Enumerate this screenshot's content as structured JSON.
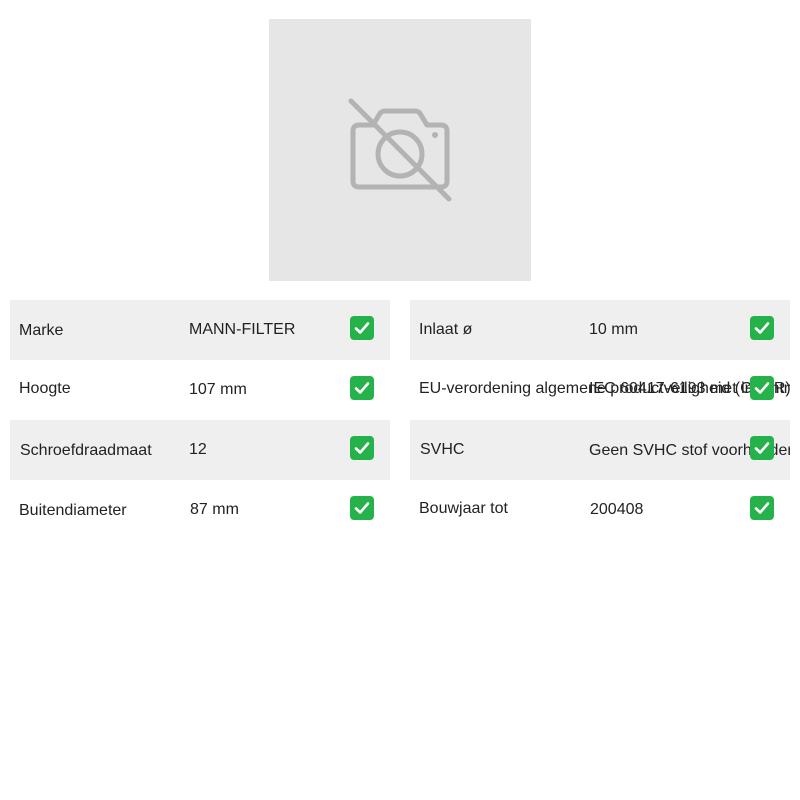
{
  "product_image": {
    "icon": "no-photo-icon"
  },
  "specs_left": [
    {
      "label": "Marke",
      "value": "MANN-FILTER"
    },
    {
      "label": "Hoogte",
      "value": "107 mm"
    },
    {
      "label": "Schroefdraadmaat",
      "value": "12"
    },
    {
      "label": "Buitendiameter",
      "value": "87 mm"
    }
  ],
  "specs_right": [
    {
      "label": "Inlaat ø",
      "value": "10 mm"
    },
    {
      "label": "EU-verordening algemene productveiligheid (GPSR)",
      "value": "IEC 60417-6193 met inachtneming"
    },
    {
      "label": "SVHC",
      "value": "Geen SVHC stof voorhanden"
    },
    {
      "label": "Bouwjaar tot",
      "value": "200408"
    }
  ],
  "check_icon": "check-icon",
  "colors": {
    "shaded_row": "#efefef",
    "placeholder_bg": "#e6e6e6",
    "check_green": "#26b24a"
  }
}
